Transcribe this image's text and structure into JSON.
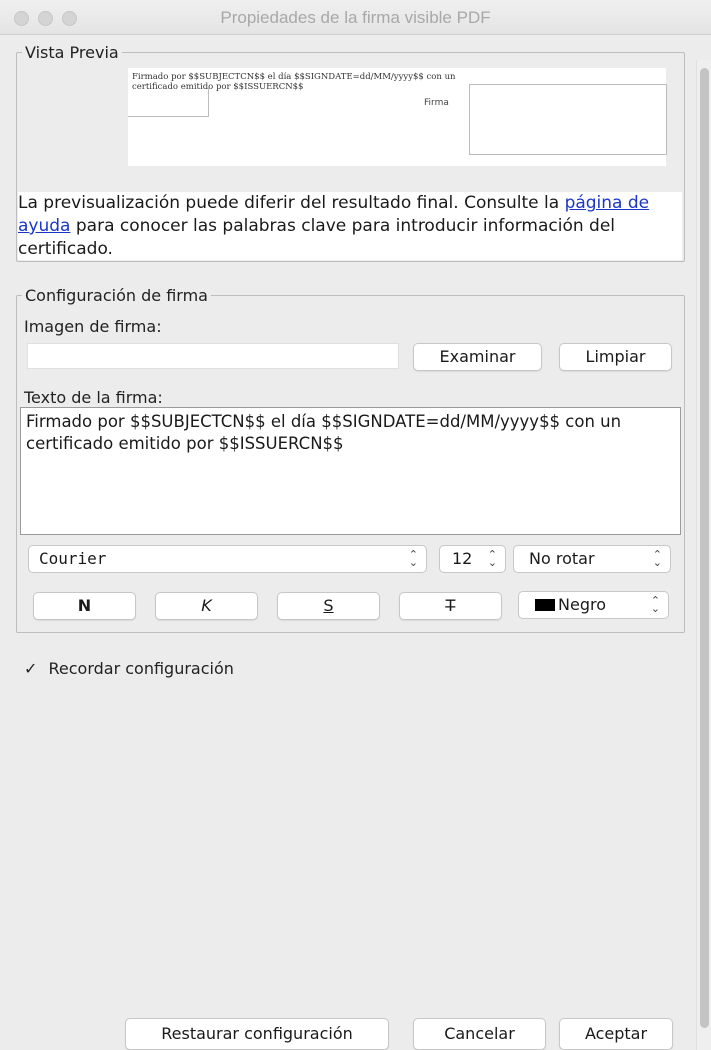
{
  "window": {
    "title": "Propiedades de la firma visible PDF"
  },
  "preview": {
    "legend": "Vista Previa",
    "line1": "Firmado por $$SUBJECTCN$$ el día $$SIGNDATE=dd/MM/yyyy$$ con un",
    "line2": "certificado emitido por $$ISSUERCN$$",
    "box_label": "Firma"
  },
  "note": {
    "text_before": "La previsualización puede diferir del resultado final. Consulte la ",
    "link": "página de ayuda",
    "text_after": " para conocer las palabras clave para introducir información del certificado."
  },
  "config": {
    "legend": "Configuración de firma",
    "image_label": "Imagen de firma:",
    "image_value": "",
    "browse_button": "Examinar",
    "clear_button": "Limpiar",
    "text_label": "Texto de la firma:",
    "text_value": "Firmado por $$SUBJECTCN$$ el día $$SIGNDATE=dd/MM/yyyy$$ con un certificado emitido por $$ISSUERCN$$",
    "font_value": "Courier",
    "size_value": "12",
    "rotation_value": "No rotar",
    "bold_button": "N",
    "italic_button": "K",
    "underline_button": "S",
    "strike_button": "T̶",
    "color_value": "Negro",
    "color_swatch": "#000000"
  },
  "remember": {
    "label": "Recordar configuración",
    "checked": true,
    "mark": "✓"
  },
  "footer": {
    "restore_button": "Restaurar configuración",
    "cancel_button": "Cancelar",
    "accept_button": "Aceptar"
  }
}
